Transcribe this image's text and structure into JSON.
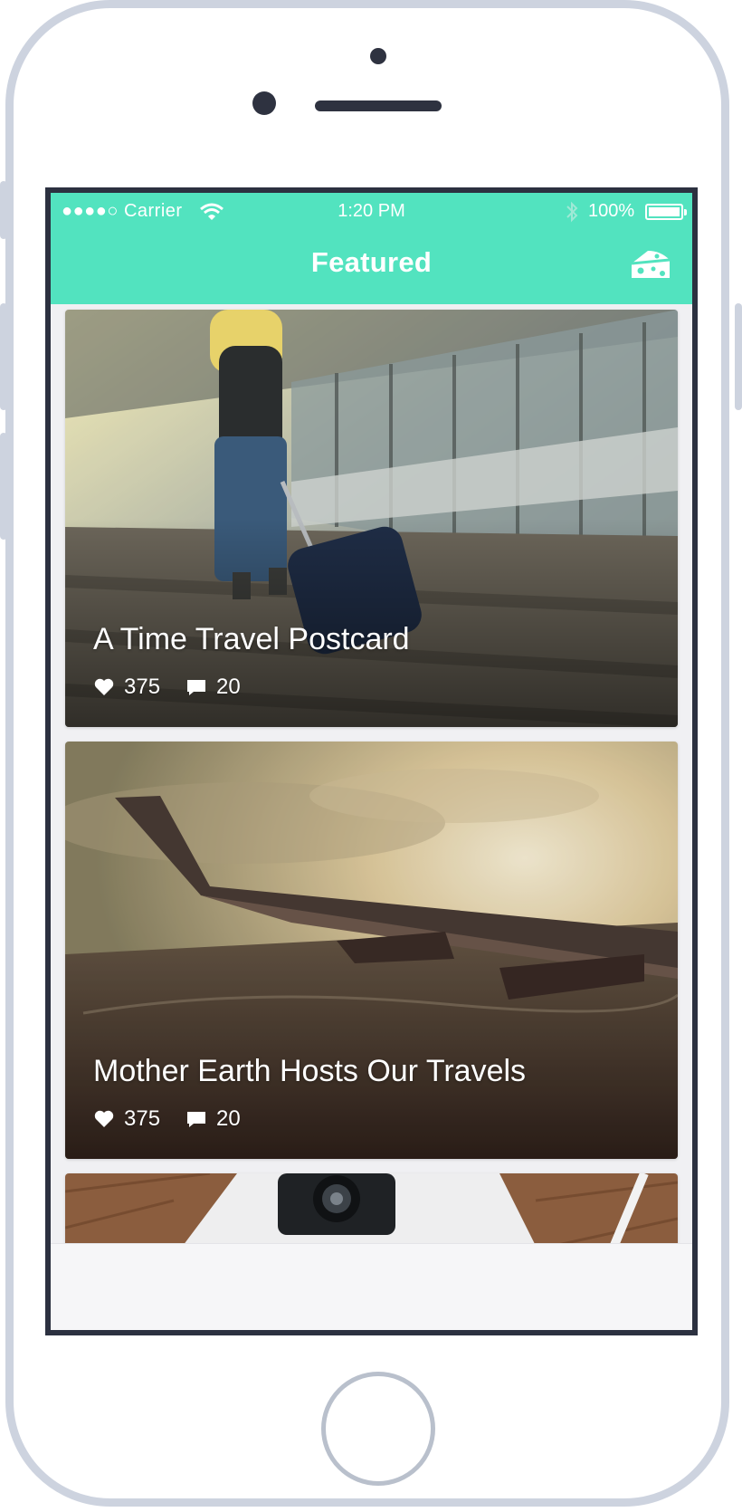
{
  "status_bar": {
    "carrier": "●●●●○ Carrier",
    "time": "1:20 PM",
    "battery": "100%"
  },
  "nav": {
    "title": "Featured",
    "right_icon": "cheese-icon"
  },
  "cards": [
    {
      "title": "A Time Travel Postcard",
      "likes": "375",
      "comments": "20",
      "image": "traveler-airport-photo"
    },
    {
      "title": "Mother Earth Hosts Our Travels",
      "likes": "375",
      "comments": "20",
      "image": "airplane-wing-photo"
    },
    {
      "title": "",
      "image": "camera-desk-photo"
    }
  ],
  "colors": {
    "accent": "#52e3bf",
    "frame": "#2c3140"
  }
}
